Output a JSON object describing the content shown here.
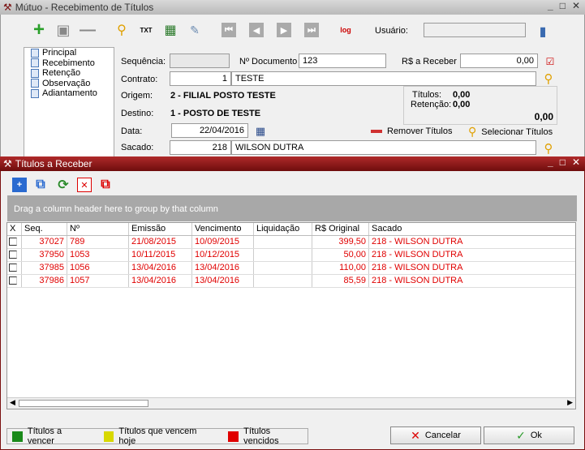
{
  "window1": {
    "title": "Mútuo - Recebimento de Títulos",
    "usuario_label": "Usuário:",
    "usuario_value": ""
  },
  "tree": [
    "Principal",
    "Recebimento",
    "Retenção",
    "Observação",
    "Adiantamento"
  ],
  "form": {
    "sequencia_label": "Sequência:",
    "sequencia_value": "",
    "documento_label": "Nº Documento",
    "documento_value": "123",
    "receber_label": "R$ a Receber",
    "receber_value": "0,00",
    "contrato_label": "Contrato:",
    "contrato_code": "1",
    "contrato_name": "TESTE",
    "origem_label": "Origem:",
    "origem_value": "2 - FILIAL POSTO TESTE",
    "destino_label": "Destino:",
    "destino_value": "1 - POSTO DE TESTE",
    "titulos_label": "Títulos:",
    "titulos_value": "0,00",
    "retencao_label": "Retenção:",
    "retencao_value": "0,00",
    "total_value": "0,00",
    "data_label": "Data:",
    "data_value": "22/04/2016",
    "remover_label": "Remover Títulos",
    "selecionar_label": "Selecionar Títulos",
    "sacado_label": "Sacado:",
    "sacado_code": "218",
    "sacado_name": "WILSON DUTRA"
  },
  "window2": {
    "title": "Títulos a Receber",
    "group_hint": "Drag a column header here to group by that column"
  },
  "table": {
    "headers": [
      "X",
      "Seq.",
      "Nº",
      "Emissão",
      "Vencimento",
      "Liquidação",
      "R$ Original",
      "Sacado"
    ],
    "rows": [
      {
        "seq": "37027",
        "num": "789",
        "emissao": "21/08/2015",
        "venc": "10/09/2015",
        "liq": "",
        "orig": "399,50",
        "sacado": "218 - WILSON DUTRA"
      },
      {
        "seq": "37950",
        "num": "1053",
        "emissao": "10/11/2015",
        "venc": "10/12/2015",
        "liq": "",
        "orig": "50,00",
        "sacado": "218 - WILSON DUTRA"
      },
      {
        "seq": "37985",
        "num": "1056",
        "emissao": "13/04/2016",
        "venc": "13/04/2016",
        "liq": "",
        "orig": "110,00",
        "sacado": "218 - WILSON DUTRA"
      },
      {
        "seq": "37986",
        "num": "1057",
        "emissao": "13/04/2016",
        "venc": "13/04/2016",
        "liq": "",
        "orig": "85,59",
        "sacado": "218 - WILSON DUTRA"
      }
    ]
  },
  "legend": [
    {
      "label": "Títulos a vencer",
      "color": "#1a8a1a"
    },
    {
      "label": "Títulos que vencem hoje",
      "color": "#d8d800"
    },
    {
      "label": "Títulos vencidos",
      "color": "#e00000"
    }
  ],
  "buttons": {
    "cancelar": "Cancelar",
    "ok": "Ok"
  }
}
